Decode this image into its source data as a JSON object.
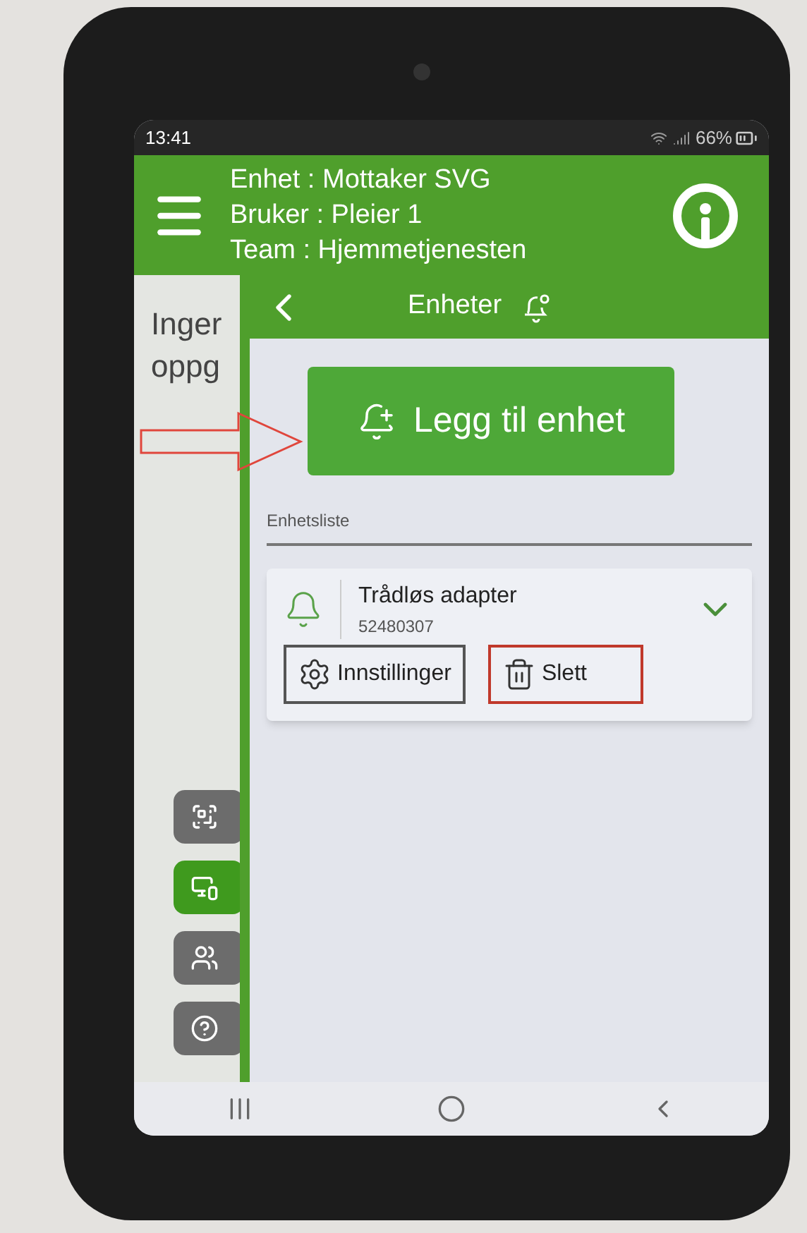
{
  "status_bar": {
    "time": "13:41",
    "battery": "66%"
  },
  "header": {
    "lines": [
      "Enhet : Mottaker SVG",
      "Bruker : Pleier 1",
      "Team : Hjemmetjenesten"
    ]
  },
  "background": {
    "texts": [
      "Inger",
      "oppg"
    ],
    "side_buttons": [
      {
        "kind": "qr",
        "selected": false
      },
      {
        "kind": "device",
        "selected": true
      },
      {
        "kind": "users",
        "selected": false
      },
      {
        "kind": "help",
        "selected": false
      }
    ]
  },
  "drawer": {
    "title": "Enheter",
    "add_button": "Legg til enhet",
    "list_label": "Enhetsliste",
    "devices": [
      {
        "name": "Trådløs adapter",
        "id": "52480307",
        "expanded": true,
        "actions": [
          {
            "kind": "settings",
            "label": "Innstillinger"
          },
          {
            "kind": "delete",
            "label": "Slett"
          }
        ]
      }
    ]
  }
}
